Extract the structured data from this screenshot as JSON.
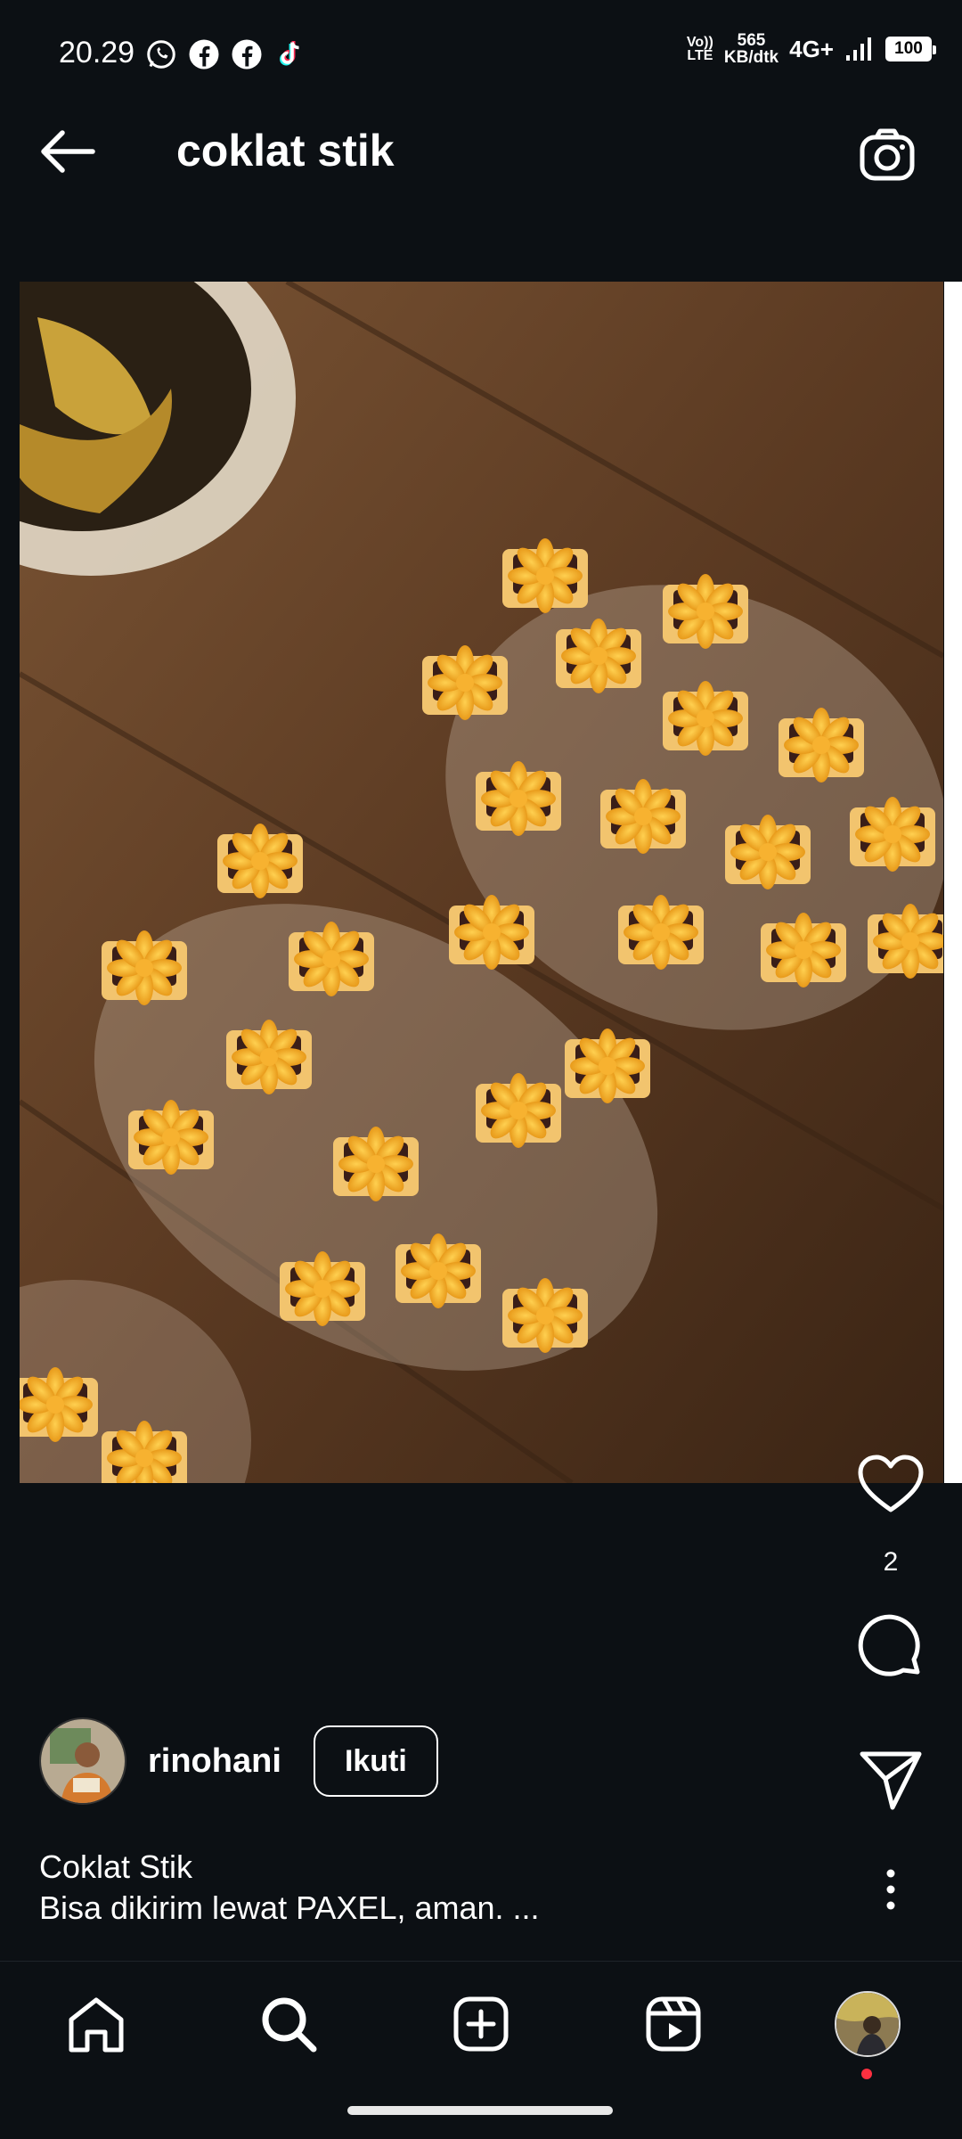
{
  "status_bar": {
    "time": "20.29",
    "app_icons": [
      "whatsapp-icon",
      "facebook-icon",
      "facebook-icon",
      "tiktok-icon"
    ],
    "volte": "Vo)) LTE",
    "net_speed_value": "565",
    "net_speed_unit": "KB/dtk",
    "network": "4G+",
    "battery": "100"
  },
  "header": {
    "title": "coklat stik"
  },
  "post": {
    "likes": "2",
    "author": "rinohani",
    "follow_label": "Ikuti",
    "caption_title": "Coklat Stik",
    "caption_body": "Bisa dikirim lewat PAXEL, aman. ..."
  },
  "bottom_nav": {
    "items": [
      "home-icon",
      "search-icon",
      "create-icon",
      "reels-icon",
      "profile-avatar"
    ]
  },
  "colors": {
    "background": "#0c1014",
    "notification_dot": "#ff3040"
  }
}
